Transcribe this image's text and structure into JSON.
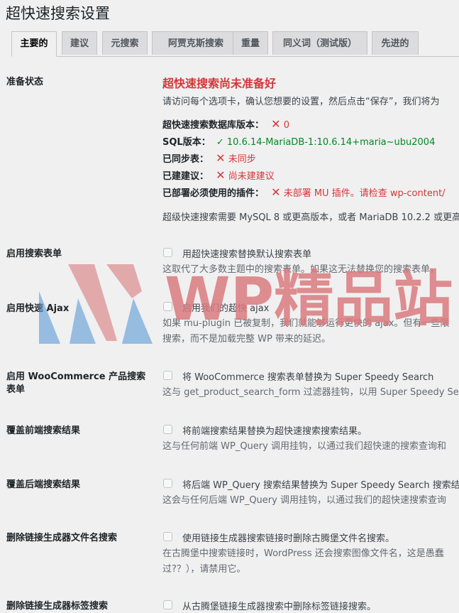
{
  "page": {
    "title": "超快速搜索设置"
  },
  "tabs": [
    {
      "label": "主要的",
      "active": true
    },
    {
      "label": "建议"
    },
    {
      "label": "元搜索"
    },
    {
      "label": "阿贾克斯搜索"
    },
    {
      "label": "重量"
    },
    {
      "label": "同义词（测试版）"
    },
    {
      "label": "先进的"
    }
  ],
  "status": {
    "label": "准备状态",
    "title": "超快速搜索尚未准备好",
    "intro": "请访问每个选项卡，确认您想要的设置，然后点击“保存”，我们将为",
    "items": [
      {
        "label": "超快速搜索数据库版本：",
        "icon": "✕",
        "value": "0"
      },
      {
        "label": "SQL版本：",
        "icon": "✓",
        "value": "10.6.14-MariaDB-1:10.6.14+maria~ubu2004"
      },
      {
        "label": "已同步表：",
        "icon": "✕",
        "value": "未同步"
      },
      {
        "label": "已建建议：",
        "icon": "✕",
        "value": "尚未建建议"
      },
      {
        "label": "已部署必须使用的插件：",
        "icon": "✕",
        "value": "未部署 MU 插件。请检查 wp-content/"
      }
    ],
    "note": "超级快速搜索需要 MySQL 8 或更高版本，或者 MariaDB 10.2.2 或更高"
  },
  "settings": [
    {
      "label": "启用搜索表单",
      "option": "用超快速搜索替换默认搜索表单",
      "desc": [
        "这取代了大多数主题中的搜索表单。如果这无法替换您的搜索表单，"
      ]
    },
    {
      "label": "启用快速 Ajax",
      "option": "启用我们的超快 ajax",
      "desc": [
        "如果 mu-plugin 已被复制，我们就能够运行更快的 ajax。但有一些限",
        "搜索，而不是加载完整 WP 带来的延迟。"
      ]
    },
    {
      "label": "启用 WooCommerce 产品搜索表单",
      "label_lines": [
        "启用 WooCommerce 产品搜索",
        "表单"
      ],
      "option": "将 WooCommerce 搜索表单替换为 Super Speedy Search",
      "desc": [
        "这与 get_product_search_form 过滤器挂钩，以用 Super Speedy Sea"
      ]
    },
    {
      "label": "覆盖前端搜索结果",
      "option": "将前端搜索结果替换为超快速搜索搜索结果。",
      "desc": [
        "这与任何前端 WP_Query 调用挂钩，以通过我们超快速的搜索查询和"
      ]
    },
    {
      "label": "覆盖后端搜索结果",
      "option": "将后端 WP_Query 搜索结果替换为 Super Speedy Search 搜索结",
      "desc": [
        "这会与任何后端 WP_Query 调用挂钩，以通过我们的超快速搜索查询"
      ]
    },
    {
      "label": "删除链接生成器文件名搜索",
      "option": "使用链接生成器搜索链接时删除古腾堡文件名搜索。",
      "desc": [
        "在古腾堡中搜索链接时，WordPress 还会搜索图像文件名，这是愚蠢",
        "过?？），请禁用它。"
      ]
    },
    {
      "label": "删除链接生成器标签搜索",
      "option": "从古腾堡链接生成器搜索中删除标签链接搜索。"
    }
  ],
  "watermark": {
    "text": "WP精品站"
  },
  "colors": {
    "error": "#d63638",
    "ok": "#008a20",
    "background": "#f0f0f1"
  }
}
